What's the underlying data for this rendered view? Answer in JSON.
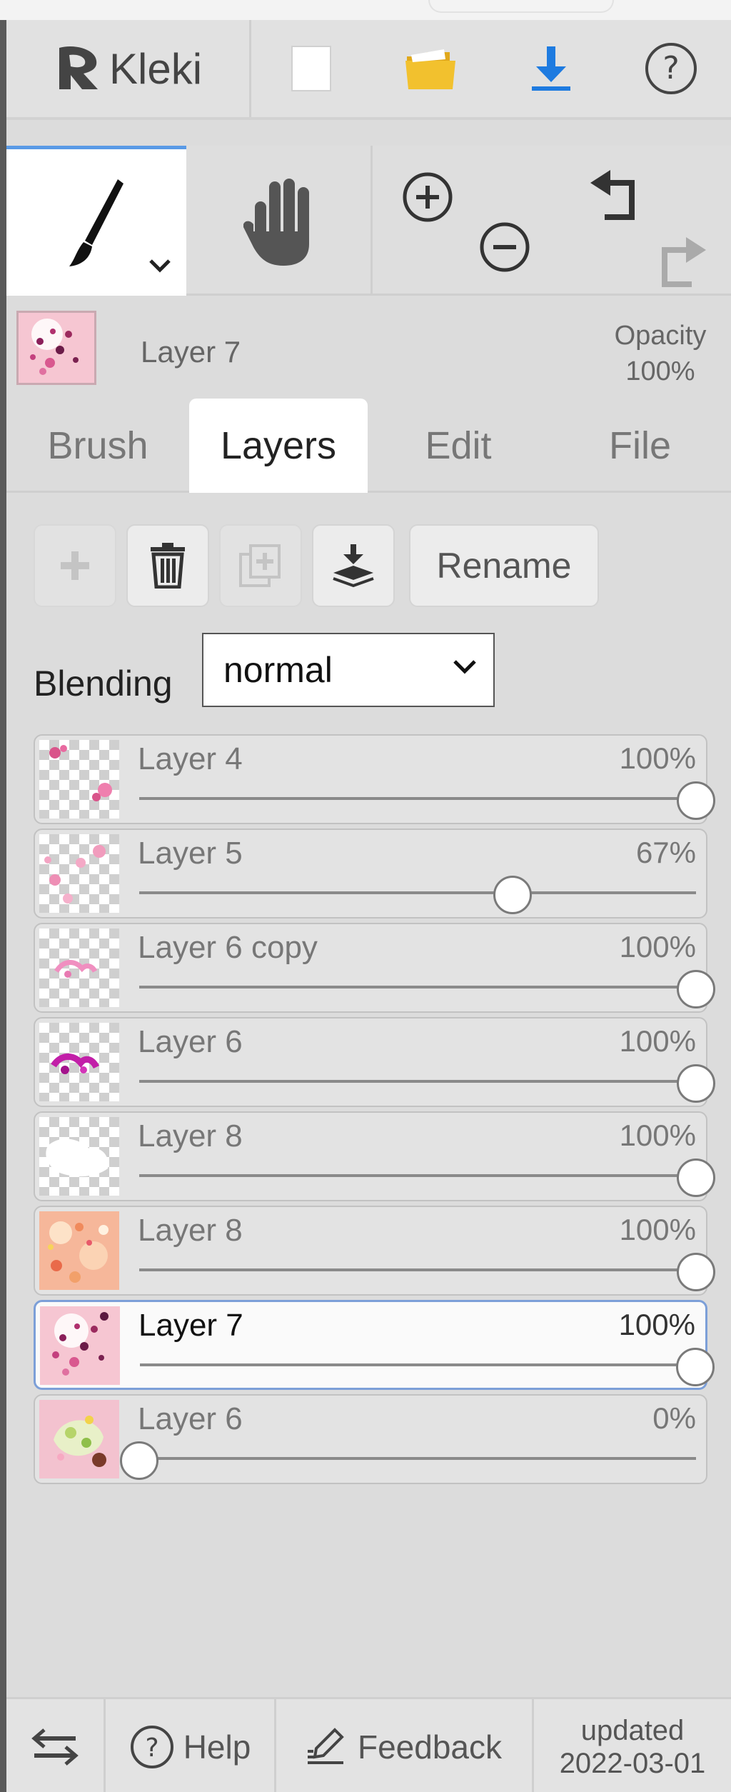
{
  "app": {
    "name": "Kleki"
  },
  "current_layer": {
    "name": "Layer 7",
    "opacity_label": "Opacity",
    "opacity_value": "100%"
  },
  "tabs": [
    {
      "label": "Brush",
      "active": false
    },
    {
      "label": "Layers",
      "active": true
    },
    {
      "label": "Edit",
      "active": false
    },
    {
      "label": "File",
      "active": false
    }
  ],
  "layer_actions": {
    "rename_label": "Rename"
  },
  "blending": {
    "label": "Blending",
    "value": "normal"
  },
  "layers": [
    {
      "name": "Layer 4",
      "opacity_label": "100%",
      "opacity": 1.0,
      "selected": false
    },
    {
      "name": "Layer 5",
      "opacity_label": "67%",
      "opacity": 0.67,
      "selected": false
    },
    {
      "name": "Layer 6 copy",
      "opacity_label": "100%",
      "opacity": 1.0,
      "selected": false
    },
    {
      "name": "Layer 6",
      "opacity_label": "100%",
      "opacity": 1.0,
      "selected": false
    },
    {
      "name": "Layer 8",
      "opacity_label": "100%",
      "opacity": 1.0,
      "selected": false
    },
    {
      "name": "Layer 8",
      "opacity_label": "100%",
      "opacity": 1.0,
      "selected": false
    },
    {
      "name": "Layer 7",
      "opacity_label": "100%",
      "opacity": 1.0,
      "selected": true
    },
    {
      "name": "Layer 6",
      "opacity_label": "0%",
      "opacity": 0.0,
      "selected": false
    }
  ],
  "footer": {
    "help_label": "Help",
    "feedback_label": "Feedback",
    "updated_label": "updated",
    "updated_date": "2022-03-01"
  },
  "colors": {
    "accent": "#5a9ae6",
    "download_blue": "#1e7be0",
    "folder_yellow": "#f2c12e",
    "selected_border": "#7c9fd8"
  },
  "icons": [
    "kleki-logo-icon",
    "new-file-icon",
    "open-folder-icon",
    "download-icon",
    "help-icon",
    "brush-icon",
    "chevron-down-icon",
    "hand-icon",
    "zoom-in-icon",
    "zoom-out-icon",
    "undo-icon",
    "redo-icon",
    "add-layer-icon",
    "trash-icon",
    "duplicate-icon",
    "merge-down-icon",
    "swap-icon",
    "feedback-icon"
  ]
}
